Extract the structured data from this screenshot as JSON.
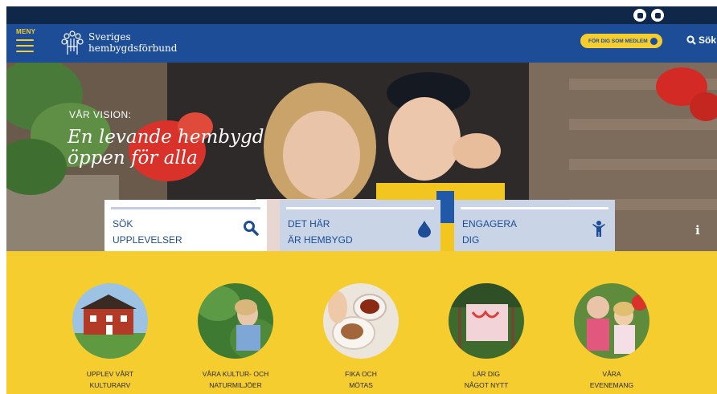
{
  "header": {
    "menu_label": "MENY",
    "logo_text_line1": "Sveriges",
    "logo_text_line2": "hembygdsförbund",
    "member_button": "FÖR DIG SOM MEDLEM",
    "search_label": "Sök"
  },
  "topbar": {
    "social_icons": [
      "facebook-icon",
      "instagram-icon"
    ]
  },
  "hero": {
    "vision_label": "VÅR VISION:",
    "vision_text": "En levande hembygd\nöppen för alla"
  },
  "quick_links": [
    {
      "label": "SÖK\nUPPLEVELSER",
      "icon": "search-icon"
    },
    {
      "label": "DET HÄR\nÄR HEMBYGD",
      "icon": "drop-icon"
    },
    {
      "label": "ENGAGERA\nDIG",
      "icon": "person-icon"
    }
  ],
  "categories": [
    {
      "label": "UPPLEV VÅRT\nKULTURARV"
    },
    {
      "label": "VÅRA KULTUR- OCH\nNATURMILJÖER"
    },
    {
      "label": "FIKA OCH\nMÖTAS"
    },
    {
      "label": "LÄR DIG\nNÅGOT NYTT"
    },
    {
      "label": "VÅRA\nEVENEMANG"
    }
  ],
  "colors": {
    "navy": "#0f2748",
    "header_blue": "#1d4d97",
    "yellow": "#f5cd2e",
    "light_blue": "#c9d5e6"
  }
}
